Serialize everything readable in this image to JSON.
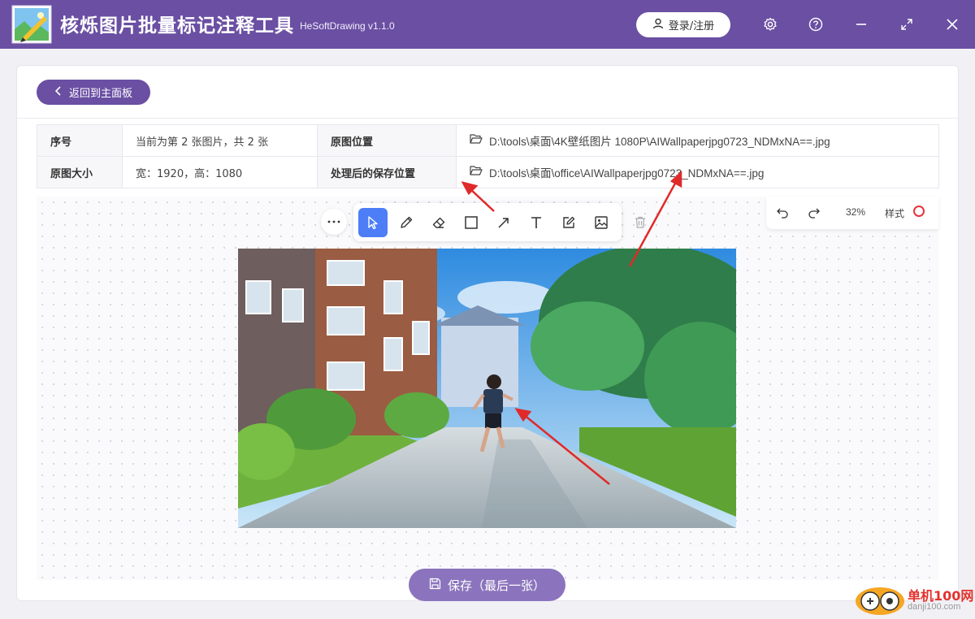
{
  "app": {
    "title": "核烁图片批量标记注释工具",
    "version": "HeSoftDrawing v1.1.0",
    "login_label": "登录/注册",
    "accent_color": "#6a4fa3",
    "icons": [
      "gear-icon",
      "help-icon",
      "minimize-icon",
      "maximize-icon",
      "close-icon"
    ]
  },
  "back_button": {
    "label": "返回到主面板"
  },
  "info": {
    "index_label": "序号",
    "index_value": "当前为第 2 张图片，共 2 张",
    "source_label": "原图位置",
    "source_path": "D:\\tools\\桌面\\4K壁纸图片 1080P\\AIWallpaperjpg0723_NDMxNA==.jpg",
    "size_label": "原图大小",
    "size_value": "宽：1920，高：1080",
    "save_location_label": "处理后的保存位置",
    "save_path": "D:\\tools\\桌面\\office\\AIWallpaperjpg0723_NDMxNA==.jpg"
  },
  "toolbar": {
    "tools": [
      "select-tool",
      "pencil-tool",
      "eraser-tool",
      "rectangle-tool",
      "arrow-tool",
      "text-tool",
      "note-tool",
      "image-tool"
    ],
    "active_tool": "select-tool"
  },
  "right_toolbar": {
    "zoom": "32%",
    "style_label": "样式",
    "style_color": "#e5343f"
  },
  "save_button": {
    "label": "保存（最后一张）"
  },
  "watermark": {
    "line1": "单机100网",
    "line2": "danji100.com"
  }
}
